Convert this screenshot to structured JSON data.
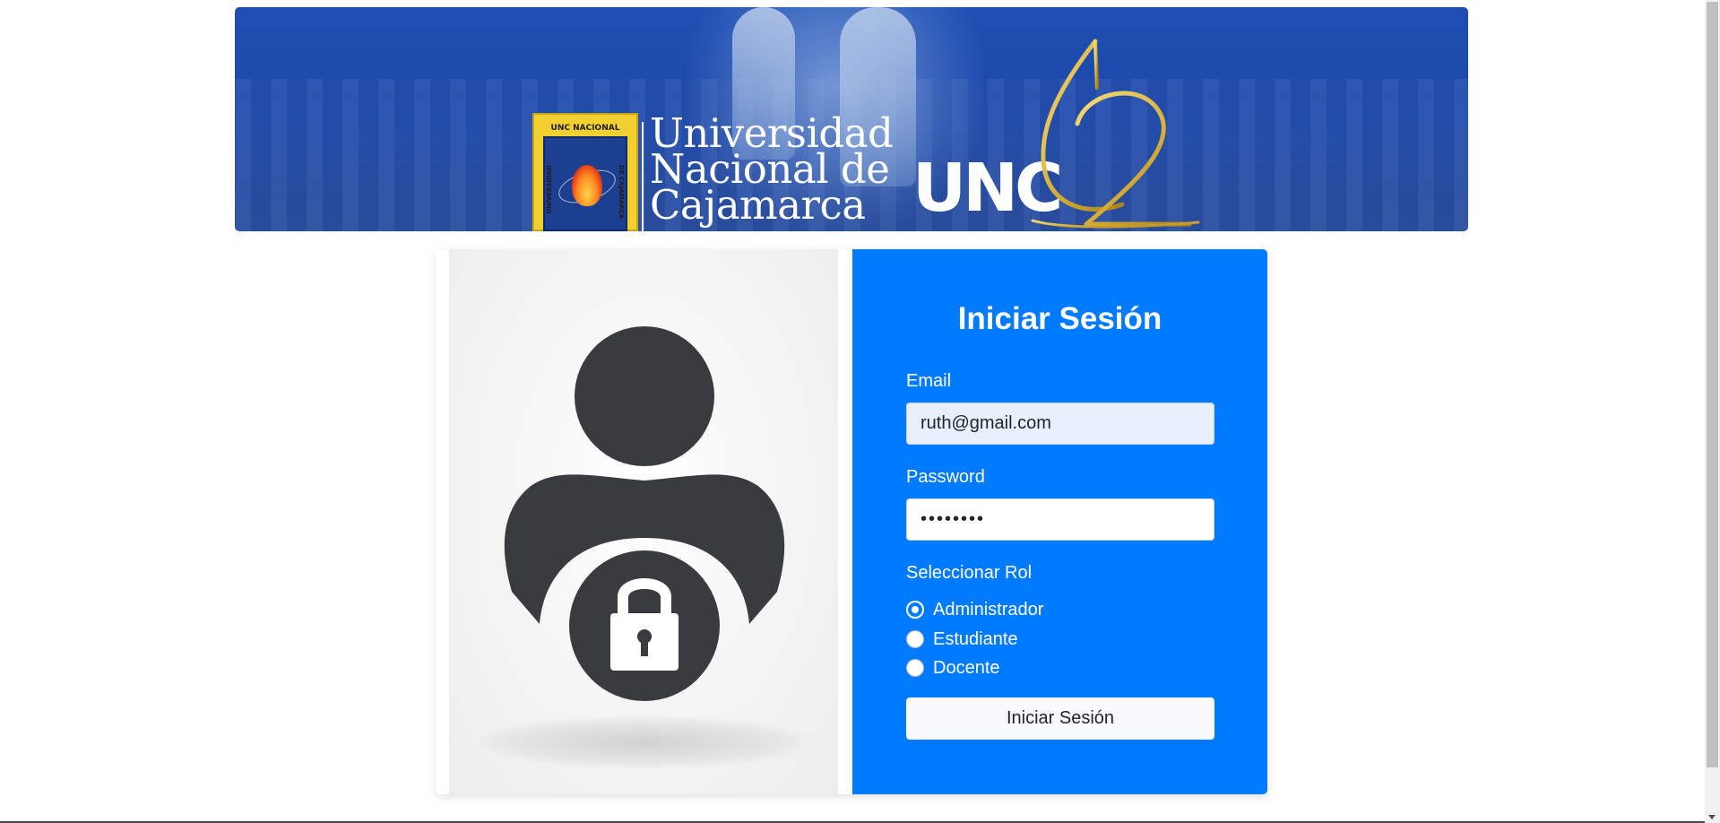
{
  "banner": {
    "shield_top": "UNC NACIONAL",
    "shield_left": "UNIVERSIDAD",
    "shield_right": "DE CAJAMARCA",
    "name_line1": "Universidad",
    "name_line2": "Nacional de",
    "name_line3": "Cajamarca",
    "acronym": "UNC",
    "anniversary": "62"
  },
  "login": {
    "title": "Iniciar Sesión",
    "email_label": "Email",
    "email_value": "ruth@gmail.com",
    "password_label": "Password",
    "password_value": "••••••••",
    "role_label": "Seleccionar Rol",
    "roles": [
      {
        "label": "Administrador",
        "checked": true
      },
      {
        "label": "Estudiante",
        "checked": false
      },
      {
        "label": "Docente",
        "checked": false
      }
    ],
    "submit_label": "Iniciar Sesión"
  },
  "colors": {
    "primary": "#007bff",
    "banner_blue": "#1f4fb3",
    "gold": "#d9b13a",
    "icon_dark": "#3a3b3f"
  }
}
